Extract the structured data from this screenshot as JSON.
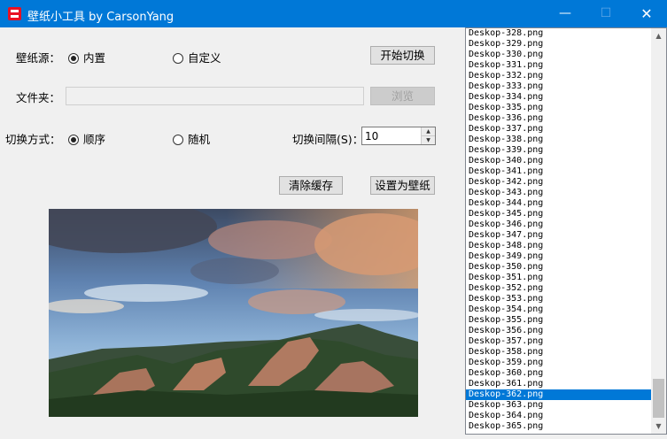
{
  "window": {
    "title": "壁纸小工具 by CarsonYang"
  },
  "source": {
    "label": "壁纸源：",
    "options": [
      {
        "label": "内置",
        "selected": true
      },
      {
        "label": "自定义",
        "selected": false
      }
    ],
    "start_button": "开始切换"
  },
  "folder": {
    "label": "文件夹：",
    "value": "",
    "browse_button": "浏览"
  },
  "mode": {
    "label": "切换方式：",
    "options": [
      {
        "label": "顺序",
        "selected": true
      },
      {
        "label": "随机",
        "selected": false
      }
    ],
    "interval_label": "切换间隔(S)：",
    "interval_value": "10"
  },
  "actions": {
    "clear_cache": "清除缓存",
    "set_wallpaper": "设置为壁纸"
  },
  "file_list": {
    "items": [
      "Deskop-328.png",
      "Deskop-329.png",
      "Deskop-330.png",
      "Deskop-331.png",
      "Deskop-332.png",
      "Deskop-333.png",
      "Deskop-334.png",
      "Deskop-335.png",
      "Deskop-336.png",
      "Deskop-337.png",
      "Deskop-338.png",
      "Deskop-339.png",
      "Deskop-340.png",
      "Deskop-341.png",
      "Deskop-342.png",
      "Deskop-343.png",
      "Deskop-344.png",
      "Deskop-345.png",
      "Deskop-346.png",
      "Deskop-347.png",
      "Deskop-348.png",
      "Deskop-349.png",
      "Deskop-350.png",
      "Deskop-351.png",
      "Deskop-352.png",
      "Deskop-353.png",
      "Deskop-354.png",
      "Deskop-355.png",
      "Deskop-356.png",
      "Deskop-357.png",
      "Deskop-358.png",
      "Deskop-359.png",
      "Deskop-360.png",
      "Deskop-361.png",
      "Deskop-362.png",
      "Deskop-363.png",
      "Deskop-364.png",
      "Deskop-365.png"
    ],
    "selected_index": 34
  },
  "colors": {
    "titlebar": "#0078d7",
    "selection": "#0078d7",
    "app_icon": "#e81123"
  },
  "icons": {
    "minimize": "minimize-icon",
    "maximize": "maximize-icon",
    "close": "close-icon"
  }
}
